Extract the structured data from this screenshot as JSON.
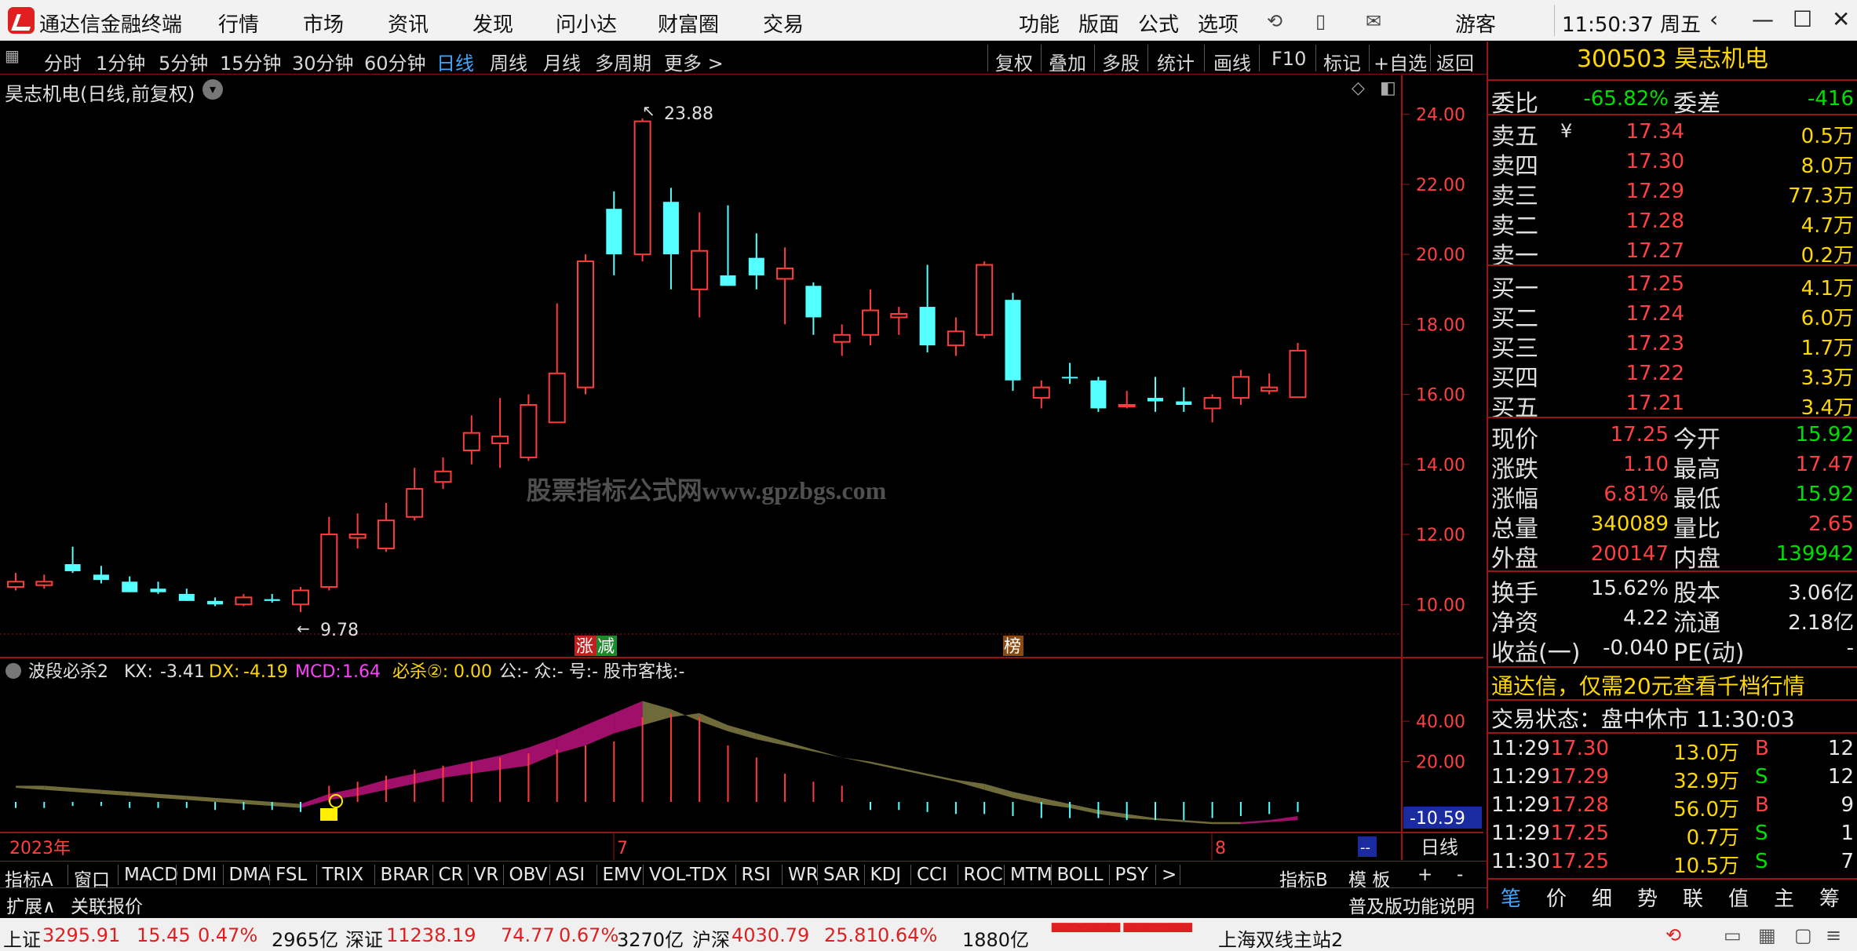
{
  "app": {
    "title": "通达信金融终端",
    "menus": [
      "行情",
      "市场",
      "资讯",
      "发现",
      "问小达",
      "财富圈",
      "交易"
    ],
    "right_menus": [
      "功能",
      "版面",
      "公式",
      "选项"
    ],
    "user": "游客",
    "clock": "11:50:37 周五"
  },
  "period_bar": {
    "items": [
      "分时",
      "1分钟",
      "5分钟",
      "15分钟",
      "30分钟",
      "60分钟",
      "日线",
      "周线",
      "月线",
      "多周期",
      "更多 >"
    ],
    "active": "日线",
    "right_items": [
      "复权",
      "叠加",
      "多股",
      "统计",
      "画线",
      "F10",
      "标记",
      "+自选",
      "返回"
    ]
  },
  "chart_title": "昊志机电(日线,前复权)",
  "chart_data": {
    "type": "candlestick",
    "ylim": [
      9.2,
      24.8
    ],
    "y_ticks": [
      "24.00",
      "22.00",
      "20.00",
      "18.00",
      "16.00",
      "14.00",
      "12.00",
      "10.00"
    ],
    "candles": [
      {
        "o": 10.5,
        "h": 10.9,
        "l": 10.4,
        "c": 10.65,
        "up": true
      },
      {
        "o": 10.55,
        "h": 10.85,
        "l": 10.45,
        "c": 10.65,
        "up": true
      },
      {
        "o": 11.15,
        "h": 11.65,
        "l": 10.9,
        "c": 10.95,
        "up": false
      },
      {
        "o": 10.85,
        "h": 11.1,
        "l": 10.6,
        "c": 10.7,
        "up": false
      },
      {
        "o": 10.65,
        "h": 10.8,
        "l": 10.35,
        "c": 10.35,
        "up": false
      },
      {
        "o": 10.45,
        "h": 10.65,
        "l": 10.3,
        "c": 10.35,
        "up": false
      },
      {
        "o": 10.3,
        "h": 10.45,
        "l": 10.1,
        "c": 10.1,
        "up": false
      },
      {
        "o": 10.1,
        "h": 10.2,
        "l": 9.95,
        "c": 10.0,
        "up": false
      },
      {
        "o": 10.0,
        "h": 10.3,
        "l": 9.95,
        "c": 10.2,
        "up": true
      },
      {
        "o": 10.15,
        "h": 10.3,
        "l": 10.05,
        "c": 10.1,
        "up": false
      },
      {
        "o": 10.0,
        "h": 10.5,
        "l": 9.78,
        "c": 10.4,
        "up": true
      },
      {
        "o": 10.5,
        "h": 12.5,
        "l": 10.4,
        "c": 12.0,
        "up": true
      },
      {
        "o": 11.9,
        "h": 12.6,
        "l": 11.6,
        "c": 12.0,
        "up": true
      },
      {
        "o": 11.6,
        "h": 12.9,
        "l": 11.5,
        "c": 12.4,
        "up": true
      },
      {
        "o": 12.5,
        "h": 13.9,
        "l": 12.4,
        "c": 13.3,
        "up": true
      },
      {
        "o": 13.5,
        "h": 14.2,
        "l": 13.3,
        "c": 13.8,
        "up": true
      },
      {
        "o": 14.4,
        "h": 15.4,
        "l": 14.0,
        "c": 14.9,
        "up": true
      },
      {
        "o": 14.6,
        "h": 15.9,
        "l": 13.9,
        "c": 14.8,
        "up": true
      },
      {
        "o": 14.2,
        "h": 16.0,
        "l": 14.1,
        "c": 15.7,
        "up": true
      },
      {
        "o": 15.2,
        "h": 18.6,
        "l": 15.2,
        "c": 16.6,
        "up": true
      },
      {
        "o": 16.2,
        "h": 20.0,
        "l": 16.0,
        "c": 19.8,
        "up": true
      },
      {
        "o": 21.3,
        "h": 21.8,
        "l": 19.4,
        "c": 20.0,
        "up": false
      },
      {
        "o": 20.0,
        "h": 23.88,
        "l": 19.8,
        "c": 23.8,
        "up": true
      },
      {
        "o": 21.5,
        "h": 21.9,
        "l": 19.0,
        "c": 20.0,
        "up": false
      },
      {
        "o": 19.0,
        "h": 21.2,
        "l": 18.2,
        "c": 20.1,
        "up": true
      },
      {
        "o": 19.4,
        "h": 21.4,
        "l": 19.1,
        "c": 19.1,
        "up": false
      },
      {
        "o": 19.9,
        "h": 20.6,
        "l": 19.0,
        "c": 19.4,
        "up": false
      },
      {
        "o": 19.3,
        "h": 20.2,
        "l": 18.0,
        "c": 19.6,
        "up": true
      },
      {
        "o": 19.1,
        "h": 19.2,
        "l": 17.7,
        "c": 18.2,
        "up": false
      },
      {
        "o": 17.5,
        "h": 18.0,
        "l": 17.1,
        "c": 17.7,
        "up": true
      },
      {
        "o": 17.7,
        "h": 19.0,
        "l": 17.4,
        "c": 18.4,
        "up": true
      },
      {
        "o": 18.2,
        "h": 18.5,
        "l": 17.7,
        "c": 18.3,
        "up": true
      },
      {
        "o": 18.5,
        "h": 19.7,
        "l": 17.2,
        "c": 17.4,
        "up": false
      },
      {
        "o": 17.4,
        "h": 18.2,
        "l": 17.1,
        "c": 17.8,
        "up": true
      },
      {
        "o": 17.7,
        "h": 19.8,
        "l": 17.6,
        "c": 19.7,
        "up": true
      },
      {
        "o": 18.7,
        "h": 18.9,
        "l": 16.1,
        "c": 16.4,
        "up": false
      },
      {
        "o": 15.9,
        "h": 16.4,
        "l": 15.6,
        "c": 16.2,
        "up": true
      },
      {
        "o": 16.5,
        "h": 16.9,
        "l": 16.3,
        "c": 16.5,
        "up": false
      },
      {
        "o": 16.4,
        "h": 16.5,
        "l": 15.5,
        "c": 15.6,
        "up": false
      },
      {
        "o": 15.7,
        "h": 16.1,
        "l": 15.6,
        "c": 15.7,
        "up": true
      },
      {
        "o": 15.9,
        "h": 16.5,
        "l": 15.5,
        "c": 15.8,
        "up": false
      },
      {
        "o": 15.8,
        "h": 16.2,
        "l": 15.5,
        "c": 15.7,
        "up": false
      },
      {
        "o": 15.6,
        "h": 16.0,
        "l": 15.2,
        "c": 15.9,
        "up": true
      },
      {
        "o": 15.9,
        "h": 16.7,
        "l": 15.7,
        "c": 16.5,
        "up": true
      },
      {
        "o": 16.1,
        "h": 16.6,
        "l": 16.0,
        "c": 16.2,
        "up": true
      },
      {
        "o": 15.92,
        "h": 17.47,
        "l": 15.92,
        "c": 17.25,
        "up": true
      }
    ],
    "annotations": {
      "high": "23.88",
      "low": "9.78",
      "tag_zhang": "涨",
      "tag_jian": "减",
      "tag_bang": "榜"
    },
    "watermark": "股票指标公式网www.gpzbgs.com",
    "x_labels": [
      "2023年",
      "7",
      "8"
    ],
    "indicator": {
      "name": "波段必杀2",
      "params": [
        {
          "label": "KX:",
          "value": "-3.41"
        },
        {
          "label": "DX:",
          "value": "-4.19"
        },
        {
          "label": "MCD:",
          "value": "1.64"
        },
        {
          "label": "必杀②:",
          "value": "0.00"
        }
      ],
      "extra": "公:- 众:- 号:- 股市客栈:-",
      "ylim": [
        -14,
        56
      ],
      "y_ticks": [
        "40.00",
        "20.00"
      ],
      "current": "-10.59",
      "upper": [
        8,
        8,
        7,
        6,
        5,
        4,
        3,
        2,
        1,
        0,
        -1,
        4,
        7,
        11,
        14,
        17,
        20,
        23,
        27,
        32,
        38,
        44,
        50,
        46,
        40,
        35,
        31,
        28,
        25,
        22,
        20,
        17,
        14,
        11,
        9,
        5,
        2,
        -1,
        -4,
        -6,
        -8,
        -9,
        -10,
        -10,
        -9,
        -7
      ],
      "lower": [
        7,
        6,
        5,
        4,
        3,
        2,
        1,
        0,
        -1,
        -2,
        -3,
        1,
        3,
        6,
        9,
        12,
        14,
        16,
        18,
        24,
        28,
        34,
        38,
        42,
        44,
        38,
        34,
        30,
        26,
        22,
        19,
        16,
        13,
        10,
        6,
        2,
        -1,
        -3,
        -6,
        -8,
        -9,
        -10,
        -11,
        -11,
        -10,
        -9
      ],
      "bars": [
        -3,
        -3,
        -2,
        -2,
        -3,
        -3,
        -3,
        -4,
        -4,
        -4,
        -5,
        8,
        10,
        13,
        16,
        18,
        20,
        22,
        24,
        26,
        28,
        30,
        42,
        44,
        42,
        28,
        22,
        14,
        10,
        8,
        -4,
        -4,
        -5,
        -6,
        -6,
        -7,
        -8,
        -8,
        -8,
        -9,
        -9,
        -9,
        -8,
        -7,
        -6,
        -5
      ]
    }
  },
  "indicator_tabs": [
    "指标A",
    "窗口",
    "MACD",
    "DMI",
    "DMA",
    "FSL",
    "TRIX",
    "BRAR",
    "CR",
    "VR",
    "OBV",
    "ASI",
    "EMV",
    "VOL-TDX",
    "RSI",
    "WR",
    "SAR",
    "KDJ",
    "CCI",
    "ROC",
    "MTM",
    "BOLL",
    "PSY",
    ">"
  ],
  "indicator_right": [
    "指标B",
    "模 板",
    "+",
    "-"
  ],
  "bottom2": {
    "left": [
      "扩展∧",
      "关联报价"
    ],
    "right": "普及版功能说明"
  },
  "period_label": "日线",
  "stock": {
    "code": "300503",
    "name": "昊志机电"
  },
  "weibi": {
    "label1": "委比",
    "val1": "-65.82%",
    "label2": "委差",
    "val2": "-416"
  },
  "sell": [
    {
      "label": "卖五",
      "price": "17.34",
      "vol": "0.5万"
    },
    {
      "label": "卖四",
      "price": "17.30",
      "vol": "8.0万"
    },
    {
      "label": "卖三",
      "price": "17.29",
      "vol": "77.3万"
    },
    {
      "label": "卖二",
      "price": "17.28",
      "vol": "4.7万"
    },
    {
      "label": "卖一",
      "price": "17.27",
      "vol": "0.2万"
    }
  ],
  "buy": [
    {
      "label": "买一",
      "price": "17.25",
      "vol": "4.1万"
    },
    {
      "label": "买二",
      "price": "17.24",
      "vol": "6.0万"
    },
    {
      "label": "买三",
      "price": "17.23",
      "vol": "1.7万"
    },
    {
      "label": "买四",
      "price": "17.22",
      "vol": "3.3万"
    },
    {
      "label": "买五",
      "price": "17.21",
      "vol": "3.4万"
    }
  ],
  "stats": [
    {
      "l1": "现价",
      "v1": "17.25",
      "c1": "red",
      "l2": "今开",
      "v2": "15.92",
      "c2": "green"
    },
    {
      "l1": "涨跌",
      "v1": "1.10",
      "c1": "red",
      "l2": "最高",
      "v2": "17.47",
      "c2": "red"
    },
    {
      "l1": "涨幅",
      "v1": "6.81%",
      "c1": "red",
      "l2": "最低",
      "v2": "15.92",
      "c2": "green"
    },
    {
      "l1": "总量",
      "v1": "340089",
      "c1": "yellow",
      "l2": "量比",
      "v2": "2.65",
      "c2": "red"
    },
    {
      "l1": "外盘",
      "v1": "200147",
      "c1": "red",
      "l2": "内盘",
      "v2": "139942",
      "c2": "green"
    }
  ],
  "stats2": [
    {
      "l1": "换手",
      "v1": "15.62%",
      "l2": "股本",
      "v2": "3.06亿"
    },
    {
      "l1": "净资",
      "v1": "4.22",
      "l2": "流通",
      "v2": "2.18亿"
    },
    {
      "l1": "收益(一)",
      "v1": "-0.040",
      "l2": "PE(动)",
      "v2": "-"
    }
  ],
  "promo": "通达信，仅需20元查看千档行情",
  "trade_status": "交易状态：盘中休市 11:30:03",
  "ticks": [
    {
      "t": "11:29",
      "p": "17.30",
      "v": "13.0万",
      "s": "B",
      "n": "12"
    },
    {
      "t": "11:29",
      "p": "17.29",
      "v": "32.9万",
      "s": "S",
      "n": "12"
    },
    {
      "t": "11:29",
      "p": "17.28",
      "v": "56.0万",
      "s": "B",
      "n": "9"
    },
    {
      "t": "11:29",
      "p": "17.25",
      "v": "0.7万",
      "s": "S",
      "n": "1"
    },
    {
      "t": "11:30",
      "p": "17.25",
      "v": "10.5万",
      "s": "S",
      "n": "7"
    }
  ],
  "right_tabs": [
    "笔",
    "价",
    "细",
    "势",
    "联",
    "值",
    "主",
    "筹"
  ],
  "statusbar": {
    "sh": {
      "name": "上证",
      "val": "3295.91",
      "chg": "15.45",
      "pct": "0.47%",
      "amt": "2965亿"
    },
    "sz": {
      "name": "深证",
      "val": "11238.19",
      "chg": "74.77",
      "pct": "0.67%",
      "amt": "3270亿"
    },
    "hs": {
      "name": "沪深",
      "val": "4030.79",
      "chg": "25.81",
      "pct": "0.64%",
      "amt": "1880亿"
    },
    "server": "上海双线主站2"
  }
}
